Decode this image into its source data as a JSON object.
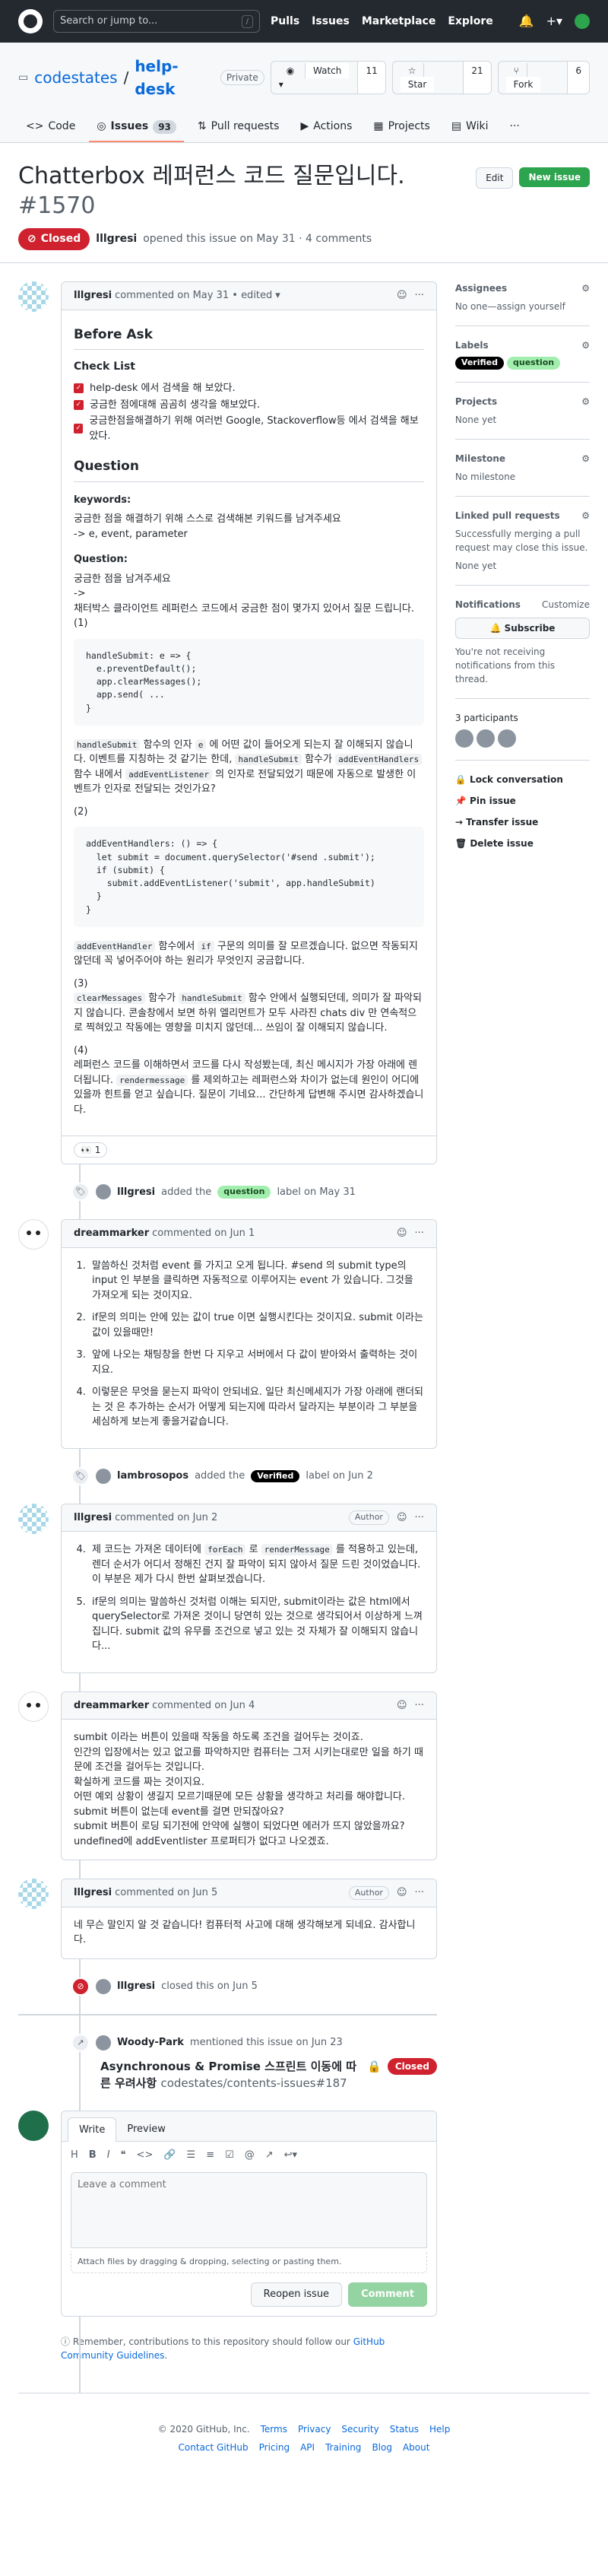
{
  "header": {
    "search_placeholder": "Search or jump to...",
    "search_key": "/",
    "nav": [
      "Pulls",
      "Issues",
      "Marketplace",
      "Explore"
    ]
  },
  "repo": {
    "owner": "codestates",
    "name": "help-desk",
    "visibility": "Private",
    "watch_label": "Watch",
    "watch_count": "11",
    "star_label": "Star",
    "star_count": "21",
    "fork_label": "Fork",
    "fork_count": "6",
    "tabs": [
      {
        "label": "Code"
      },
      {
        "label": "Issues",
        "count": "93"
      },
      {
        "label": "Pull requests"
      },
      {
        "label": "Actions"
      },
      {
        "label": "Projects"
      },
      {
        "label": "Wiki"
      }
    ],
    "more": "···"
  },
  "issue": {
    "title": "Chatterbox 레퍼런스 코드 질문입니다.",
    "number": "#1570",
    "edit_label": "Edit",
    "new_label": "New issue",
    "state": "Closed",
    "author": "lllgresi",
    "opened_text": "opened this issue on May 31 · 4 comments"
  },
  "first_comment": {
    "author": "lllgresi",
    "meta": "commented on May 31 • edited",
    "before_ask": "Before Ask",
    "checklist_title": "Check List",
    "checklist": [
      "help-desk 에서 검색을 해 보았다.",
      "궁금한 점에대해 곰곰히 생각을 해보았다.",
      "궁금한점을해결하기 위해 여러번 Google, Stackoverflow등 에서 검색을 해보았다."
    ],
    "question_title": "Question",
    "keywords_title": "keywords:",
    "keywords_body1": "궁금한 점을 해결하기 위해 스스로 검색해본 키워드를 남겨주세요",
    "keywords_body2": "-> e, event, parameter",
    "question_sub": "Question:",
    "q_intro1": "궁금한 점을 남겨주세요",
    "q_intro2": "->",
    "q_intro3": "채터박스 클라이언트 레퍼런스 코드에서 궁금한 점이 몇가지 있어서 질문 드립니다.",
    "q1_num": "(1)",
    "code1": [
      "handleSubmit: e => {",
      "  e.preventDefault();",
      "  app.clearMessages();",
      "  app.send( ...",
      "}"
    ],
    "q1_a": "handleSubmit",
    "q1_b": " 함수의 인자 ",
    "q1_c": "e",
    "q1_d": " 에 어떤 값이 들어오게 되는지 잘 이해되지 않습니다. 이벤트를 지칭하는 것 같기는 한데, ",
    "q1_e": "handleSubmit",
    "q1_f": " 함수가 ",
    "q1_g": "addEventHandlers",
    "q1_h": " 함수 내에서 ",
    "q1_i": "addEventListener",
    "q1_j": " 의 인자로 전달되었기 때문에 자동으로 발생한 이벤트가 인자로 전달되는 것인가요?",
    "q2_num": "(2)",
    "code2": [
      "addEventHandlers: () => {",
      "  let submit = document.querySelector('#send .submit');",
      "  if (submit) {",
      "    submit.addEventListener('submit', app.handleSubmit)",
      "  }",
      "}"
    ],
    "q2_a": "addEventHandler",
    "q2_b": " 함수에서 ",
    "q2_c": "if",
    "q2_d": " 구문의 의미를 잘 모르겠습니다. 없으면 작동되지 않던데 꼭 넣어주어야 하는 원리가 무엇인지 궁금합니다.",
    "q3_num": "(3)",
    "q3_a": "clearMessages",
    "q3_b": " 함수가 ",
    "q3_c": "handleSubmit",
    "q3_d": " 함수 안에서 실행되던데, 의미가 잘 파악되지 않습니다. 콘솔창에서 보면 하위 엘리먼트가 모두 사라진 chats div 만 연속적으로 찍혀있고 작동에는 영향을 미치지 않던데... 쓰임이 잘 이해되지 않습니다.",
    "q4_num": "(4)",
    "q4_a": "레퍼런스 코드를 이해하면서 코드를 다시 작성봤는데, 최신 메시지가 가장 아래에 렌더됩니다. ",
    "q4_b": "rendermessage",
    "q4_c": " 를 제외하고는 레퍼런스와 차이가 없는데 원인이 어디에 있을까 힌트를 얻고 싶습니다. 질문이 기네요... 간단하게 답변해 주시면 감사하겠습니다.",
    "reaction": "👀 1"
  },
  "event_label1": {
    "actor": "lllgresi",
    "text1": "added the",
    "label": "question",
    "text2": "label on May 31"
  },
  "comment2": {
    "author": "dreammarker",
    "meta": "commented on Jun 1",
    "items": [
      "말씀하신 것처럼 event 를 가지고 오게 됩니다. #send 의 submit type의 input 인 부분을 클릭하면 자동적으로 이루어지는 event 가 있습니다. 그것을 가져오게 되는 것이지요.",
      "if문의 의미는 안에 있는 값이 true 이면 실행시킨다는 것이지요. submit 이라는 값이 있을때만!",
      "앞에 나오는 채팅창을 한번 다 지우고 서버에서 다 값이 받아와서 출력하는 것이지요.",
      "이렇문은 무엇을 묻는지 파악이 안되네요. 일단 최신메세지가 가장 아래에 랜더되는 것 은 추가하는 순서가 어떻게 되는지에 따라서 달라지는 부분이라 그 부분을 세심하게 보는게 좋을거같습니다."
    ]
  },
  "event_label2": {
    "actor": "lambrosopos",
    "text1": "added the",
    "label": "Verified",
    "text2": "label on Jun 2"
  },
  "comment3": {
    "author": "lllgresi",
    "meta": "commented on Jun 2",
    "role": "Author",
    "item4_a": "제 코드는 가져온 데이터에 ",
    "item4_b": "forEach",
    "item4_c": " 로 ",
    "item4_d": "renderMessage",
    "item4_e": " 를 적용하고 있는데, 렌더 순서가 어디서 정해진 건지 잘 파악이 되지 않아서 질문 드린 것이었습니다. 이 부분은 제가 다시 한번 살펴보겠습니다.",
    "item5": "if문의 의미는 말씀하신 것처럼 이해는 되지만, submit이라는 값은 html에서 querySelector로 가져온 것이니 당연히 있는 것으로 생각되어서 이상하게 느껴집니다. submit 값의 유무를 조건으로 넣고 있는 것 자체가 잘 이해되지 않습니다..."
  },
  "comment4": {
    "author": "dreammarker",
    "meta": "commented on Jun 4",
    "lines": [
      "sumbit 이라는 버튼이 있을때 작동을 하도록 조건을 걸어두는 것이죠.",
      "인간의 입장에서는 있고 없고를 파악하지만 컴퓨터는 그저 시키는대로만 일을 하기 때문에 조건을 걸어두는 것입니다.",
      "확실하게 코드를 짜는 것이지요.",
      "어떤 예외 상황이 생길지 모르기때문에 모든 상황을 생각하고 처리를 해야합니다.",
      "submit 버튼이 없는데 event를 걸면 만되잖아요?",
      "submit 버튼이 로딩 되기전에 안약에 실행이 되었다면 에러가 뜨지 않았을까요?",
      "undefined에 addEventlister 프로퍼티가 없다고 나오겠죠."
    ]
  },
  "comment5": {
    "author": "lllgresi",
    "meta": "commented on Jun 5",
    "role": "Author",
    "body": "네 무슨 말인지 알 것 같습니다! 컴퓨터적 사고에 대해 생각해보게 되네요. 감사합니다."
  },
  "event_closed": {
    "actor": "lllgresi",
    "text": "closed this on Jun 5"
  },
  "mention": {
    "actor": "Woody-Park",
    "text": "mentioned this issue on Jun 23",
    "title": "Asynchronous & Promise 스프린트 이동에 따른 우려사항",
    "ref": "codestates/contents-issues#187",
    "state": "Closed"
  },
  "editor": {
    "tab_write": "Write",
    "tab_preview": "Preview",
    "placeholder": "Leave a comment",
    "attach": "Attach files by dragging & dropping, selecting or pasting them.",
    "reopen": "Reopen issue",
    "comment": "Comment",
    "guideline_prefix": "Remember, contributions to this repository should follow our",
    "guideline_link": "GitHub Community Guidelines",
    "guideline_suffix": "."
  },
  "sidebar": {
    "assignees_title": "Assignees",
    "assignees_note": "No one—assign yourself",
    "labels_title": "Labels",
    "labels": [
      "Verified",
      "question"
    ],
    "projects_title": "Projects",
    "projects_note": "None yet",
    "milestone_title": "Milestone",
    "milestone_note": "No milestone",
    "linked_title": "Linked pull requests",
    "linked_note": "Successfully merging a pull request may close this issue.",
    "linked_none": "None yet",
    "notifications_title": "Notifications",
    "customize": "Customize",
    "subscribe": "Subscribe",
    "notif_note": "You're not receiving notifications from this thread.",
    "participants": "3 participants",
    "lock": "Lock conversation",
    "pin": "Pin issue",
    "transfer": "Transfer issue",
    "delete": "Delete issue"
  },
  "footer": {
    "copyright": "© 2020 GitHub, Inc.",
    "links1": [
      "Terms",
      "Privacy",
      "Security",
      "Status",
      "Help"
    ],
    "links2": [
      "Contact GitHub",
      "Pricing",
      "API",
      "Training",
      "Blog",
      "About"
    ]
  }
}
